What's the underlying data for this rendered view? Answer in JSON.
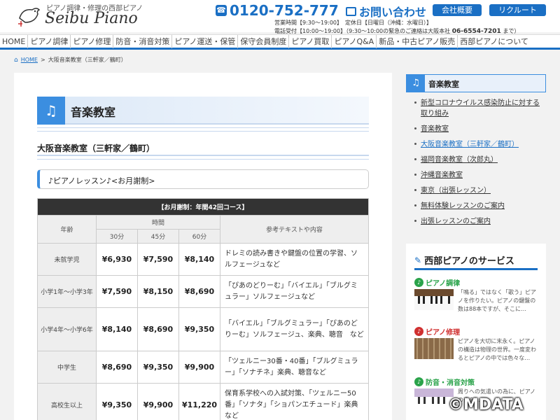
{
  "header": {
    "tagline": "ピアノ調律・修理の西部ピアノ",
    "logo": "Seibu Piano",
    "phone": "0120-752-777",
    "contact": "お問い合わせ",
    "btn_company": "会社概要",
    "btn_recruit": "リクルート",
    "hours_line": "営業時間【9:30～19:00】　定休日【日曜日（沖縄：水曜日）】",
    "phone_line_prefix": "電話受付【10:00～19:00】（9:30～10:00の緊急のご連絡は大阪本社",
    "phone_line_number": "06-6554-7201",
    "phone_line_suffix": "まで）"
  },
  "nav": [
    "HOME",
    "ピアノ調律",
    "ピアノ修理",
    "防音・消音対策",
    "ピアノ運送・保管",
    "保守会員制度",
    "ピアノ買取",
    "ピアノQ&A",
    "新品・中古ピアノ販売",
    "西部ピアノについて"
  ],
  "breadcrumb": {
    "home": "HOME",
    "sep": ">",
    "current": "大阪音楽教室（三軒家／鶴町）"
  },
  "main": {
    "title": "音楽教室",
    "subtitle": "大阪音楽教室（三軒家／鶴町）",
    "lesson_heading": "♪ピアノレッスン♪<お月謝制>"
  },
  "table": {
    "caption": "【お月謝制：年間42回コース】",
    "col_age": "年齢",
    "col_time": "時間",
    "col_ref": "参考テキストや内容",
    "durations": [
      "30分",
      "45分",
      "60分"
    ],
    "rows": [
      {
        "age": "未就学児",
        "p30": "¥6,930",
        "p45": "¥7,590",
        "p60": "¥8,140",
        "desc": "ドレミの読み書きや鍵盤の位置の学習、ソルフェージュなど"
      },
      {
        "age": "小学1年～小学3年",
        "p30": "¥7,590",
        "p45": "¥8,150",
        "p60": "¥8,690",
        "desc": "「ぴあのどりーむ」「バイエル」「ブルグミュラー」ソルフェージュなど"
      },
      {
        "age": "小学4年～小学6年",
        "p30": "¥8,140",
        "p45": "¥8,690",
        "p60": "¥9,350",
        "desc": "「バイエル」「ブルグミュラー」「ぴあのどりーむ」ソルフェージュ、楽典、聴音　など"
      },
      {
        "age": "中学生",
        "p30": "¥8,690",
        "p45": "¥9,350",
        "p60": "¥9,900",
        "desc": "「ツェルニー30番・40番」「ブルグミュラー」「ソナチネ」楽典、聴音など"
      },
      {
        "age": "高校生以上",
        "p30": "¥9,350",
        "p45": "¥9,900",
        "p60": "¥11,220",
        "desc": "保育系学校への入試対策、「ツェルニー50番」「ソナタ」「ショパンエチュード」楽典など"
      }
    ]
  },
  "sidebar": {
    "heading": "音楽教室",
    "items": [
      "新型コロナウイルス感染防止に対する取り組み",
      "音楽教室",
      "大阪音楽教室（三軒家／鶴町）",
      "福岡音楽教室（次郎丸）",
      "沖縄音楽教室",
      "東京（出張レッスン）",
      "無料体験レッスンのご案内",
      "出張レッスンのご案内"
    ],
    "services_title": "西部ピアノのサービス",
    "services": [
      {
        "title": "ピアノ調律",
        "text": "「鳴る」ではなく「歌う」ピアノを作りたい。ピアノの鍵盤の数は88本ですが、そこに…",
        "color": "#2aa34a"
      },
      {
        "title": "ピアノ修理",
        "text": "ピアノを大切に末永く。ピアノの構造は物理の世界。一度変わるとピアノの中では色々な…",
        "color": "#d03030"
      },
      {
        "title": "防音・消音対策",
        "text": "周りへの気遣いの為に、ピアノの音を…",
        "color": "#2aa34a"
      }
    ]
  },
  "copyright": "©MDATA",
  "colors": {
    "accent": "#1a6fc4",
    "icon_blue": "#3b8ee0"
  }
}
